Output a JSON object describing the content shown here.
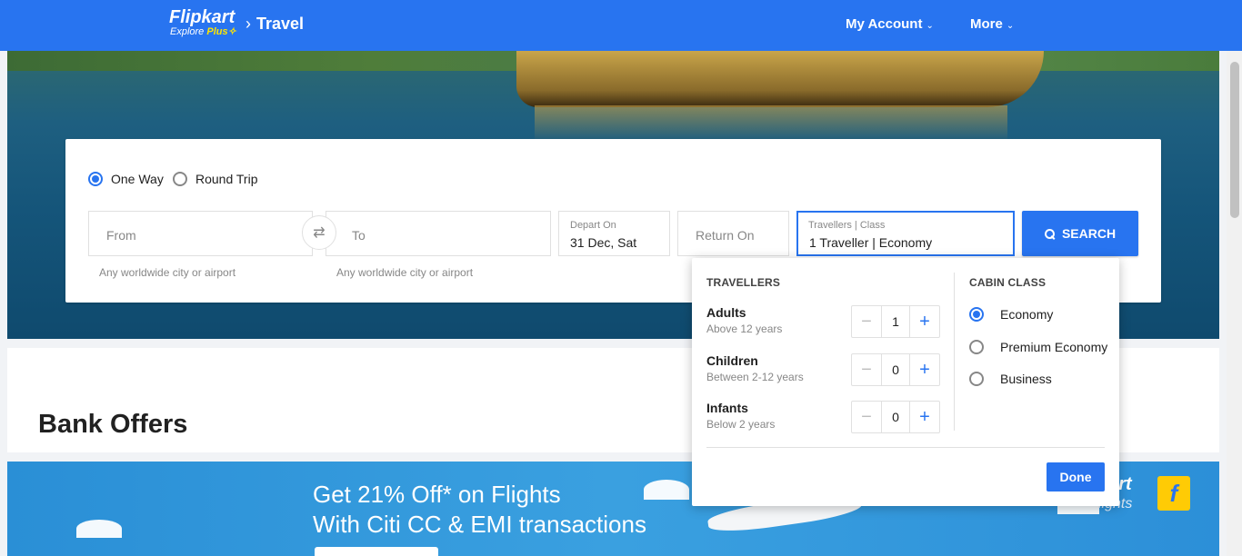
{
  "header": {
    "brand": "Flipkart",
    "brand_sub": "Explore",
    "brand_plus": "Plus",
    "section": "Travel",
    "nav": [
      {
        "label": "My Account"
      },
      {
        "label": "More"
      }
    ]
  },
  "search": {
    "trip_types": [
      {
        "label": "One Way",
        "selected": true
      },
      {
        "label": "Round Trip",
        "selected": false
      }
    ],
    "from": {
      "placeholder": "From",
      "hint": "Any worldwide city or airport"
    },
    "to": {
      "placeholder": "To",
      "hint": "Any worldwide city or airport"
    },
    "depart": {
      "label": "Depart On",
      "value": "31 Dec, Sat"
    },
    "return": {
      "placeholder": "Return On"
    },
    "travellers": {
      "label": "Travellers | Class",
      "value": "1 Traveller | Economy"
    },
    "search_label": "SEARCH"
  },
  "dropdown": {
    "travellers_heading": "TRAVELLERS",
    "cabin_heading": "CABIN CLASS",
    "passengers": [
      {
        "name": "Adults",
        "age": "Above 12 years",
        "count": "1"
      },
      {
        "name": "Children",
        "age": "Between 2-12 years",
        "count": "0"
      },
      {
        "name": "Infants",
        "age": "Below 2 years",
        "count": "0"
      }
    ],
    "cabins": [
      {
        "label": "Economy",
        "selected": true
      },
      {
        "label": "Premium Economy",
        "selected": false
      },
      {
        "label": "Business",
        "selected": false
      }
    ],
    "done_label": "Done"
  },
  "offers": {
    "title": "Bank Offers"
  },
  "banner": {
    "line1": "Get 21% Off* on Flights",
    "line2": "With Citi CC & EMI transactions",
    "brand_fragment": "kart",
    "brand_sub_fragment": "lights",
    "logo_letter": "f"
  },
  "colors": {
    "primary": "#2874f0",
    "accent_yellow": "#ffe500"
  }
}
